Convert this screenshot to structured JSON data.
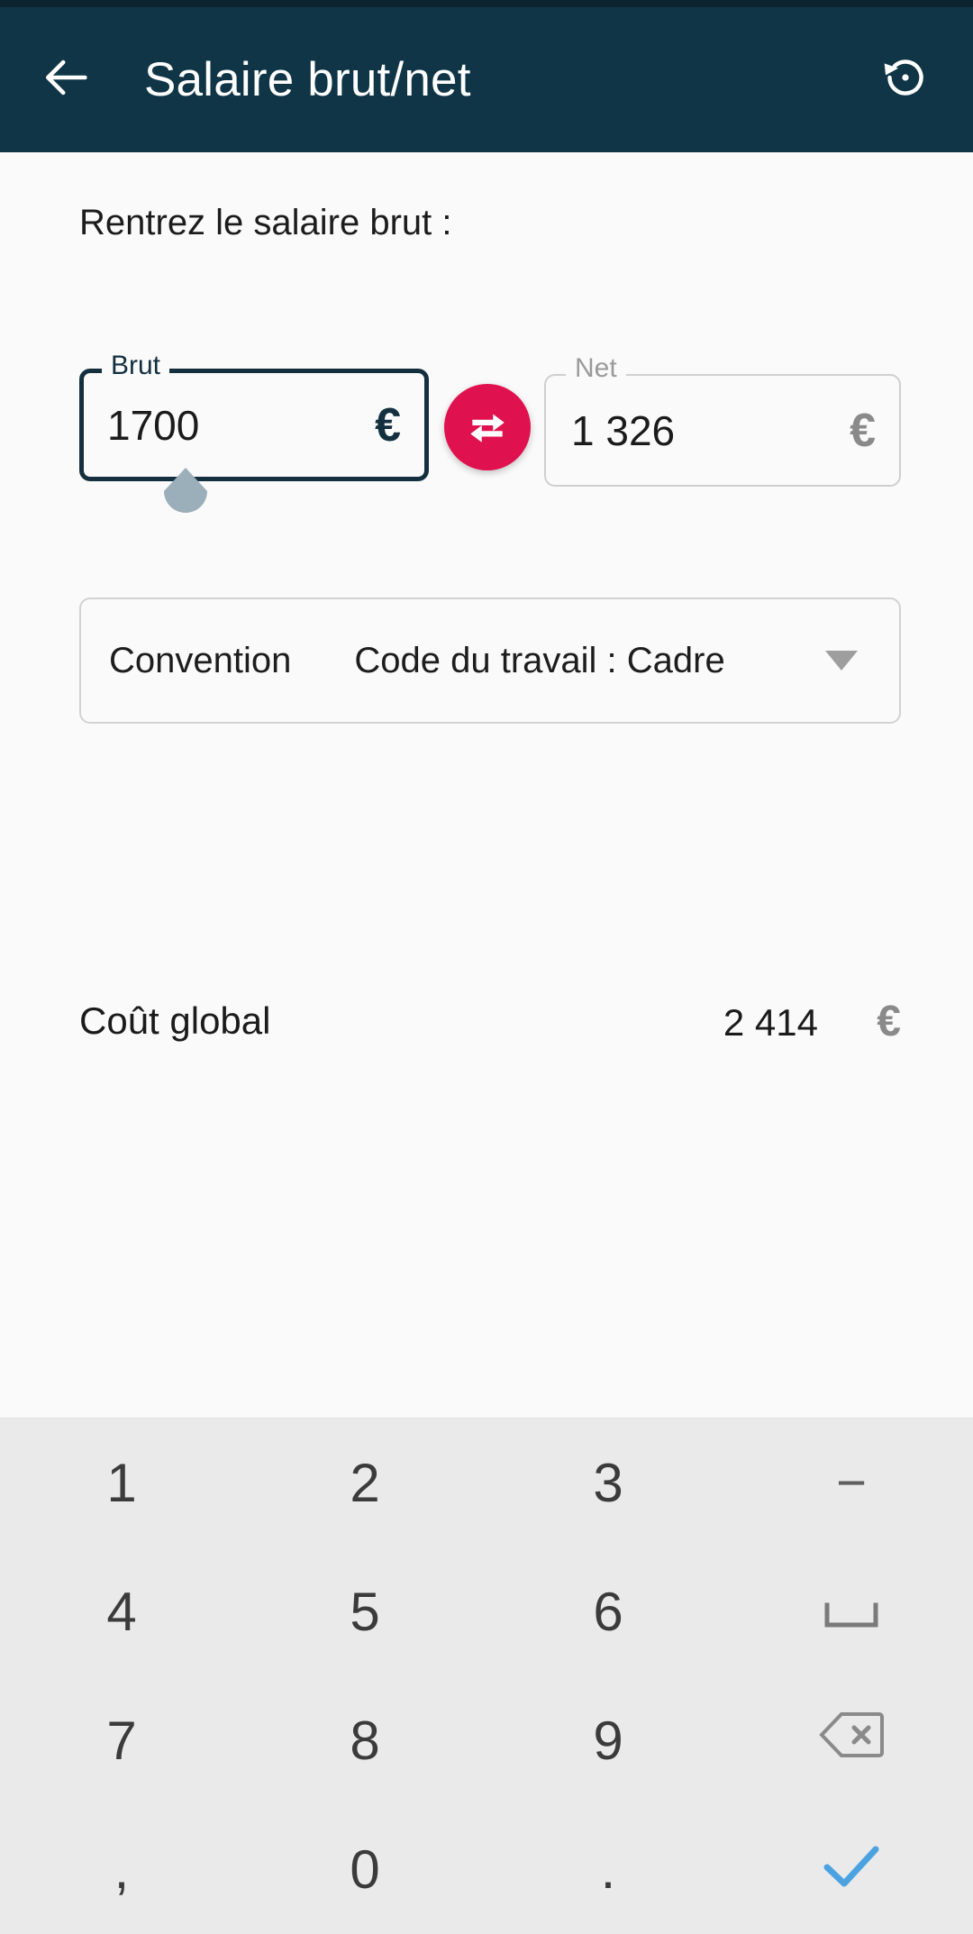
{
  "appbar": {
    "title": "Salaire brut/net",
    "back_icon": "arrow-left-icon",
    "reset_icon": "restore-icon",
    "background": "#103546"
  },
  "content": {
    "intro_text": "Rentrez le salaire brut :",
    "fields": {
      "brut": {
        "legend": "Brut",
        "value": "1700",
        "currency": "€",
        "focused": true,
        "border_color": "#14303f"
      },
      "net": {
        "legend": "Net",
        "value": "1 326",
        "currency": "€",
        "focused": false,
        "border_color": "#cfcfcf"
      }
    },
    "swap_button": {
      "icon": "swap-horizontal-icon",
      "color": "#e0114f"
    },
    "convention": {
      "label": "Convention",
      "value": "Code du travail : Cadre",
      "arrow_icon": "chevron-down-icon"
    },
    "global_cost": {
      "label": "Coût global",
      "value": "2 414",
      "currency": "€"
    }
  },
  "keyboard": {
    "background": "#eaeaea",
    "rows": [
      [
        {
          "label": "1",
          "name": "key-1",
          "kind": "digit"
        },
        {
          "label": "2",
          "name": "key-2",
          "kind": "digit"
        },
        {
          "label": "3",
          "name": "key-3",
          "kind": "digit"
        },
        {
          "label": "−",
          "name": "key-minus",
          "kind": "symbol"
        }
      ],
      [
        {
          "label": "4",
          "name": "key-4",
          "kind": "digit"
        },
        {
          "label": "5",
          "name": "key-5",
          "kind": "digit"
        },
        {
          "label": "6",
          "name": "key-6",
          "kind": "digit"
        },
        {
          "label": "",
          "name": "key-space",
          "kind": "space-icon"
        }
      ],
      [
        {
          "label": "7",
          "name": "key-7",
          "kind": "digit"
        },
        {
          "label": "8",
          "name": "key-8",
          "kind": "digit"
        },
        {
          "label": "9",
          "name": "key-9",
          "kind": "digit"
        },
        {
          "label": "",
          "name": "key-backspace",
          "kind": "backspace-icon"
        }
      ],
      [
        {
          "label": ",",
          "name": "key-comma",
          "kind": "digit"
        },
        {
          "label": "0",
          "name": "key-0",
          "kind": "digit"
        },
        {
          "label": ".",
          "name": "key-period",
          "kind": "digit"
        },
        {
          "label": "",
          "name": "key-enter",
          "kind": "check-icon"
        }
      ]
    ],
    "enter_color": "#4aa3e0"
  }
}
